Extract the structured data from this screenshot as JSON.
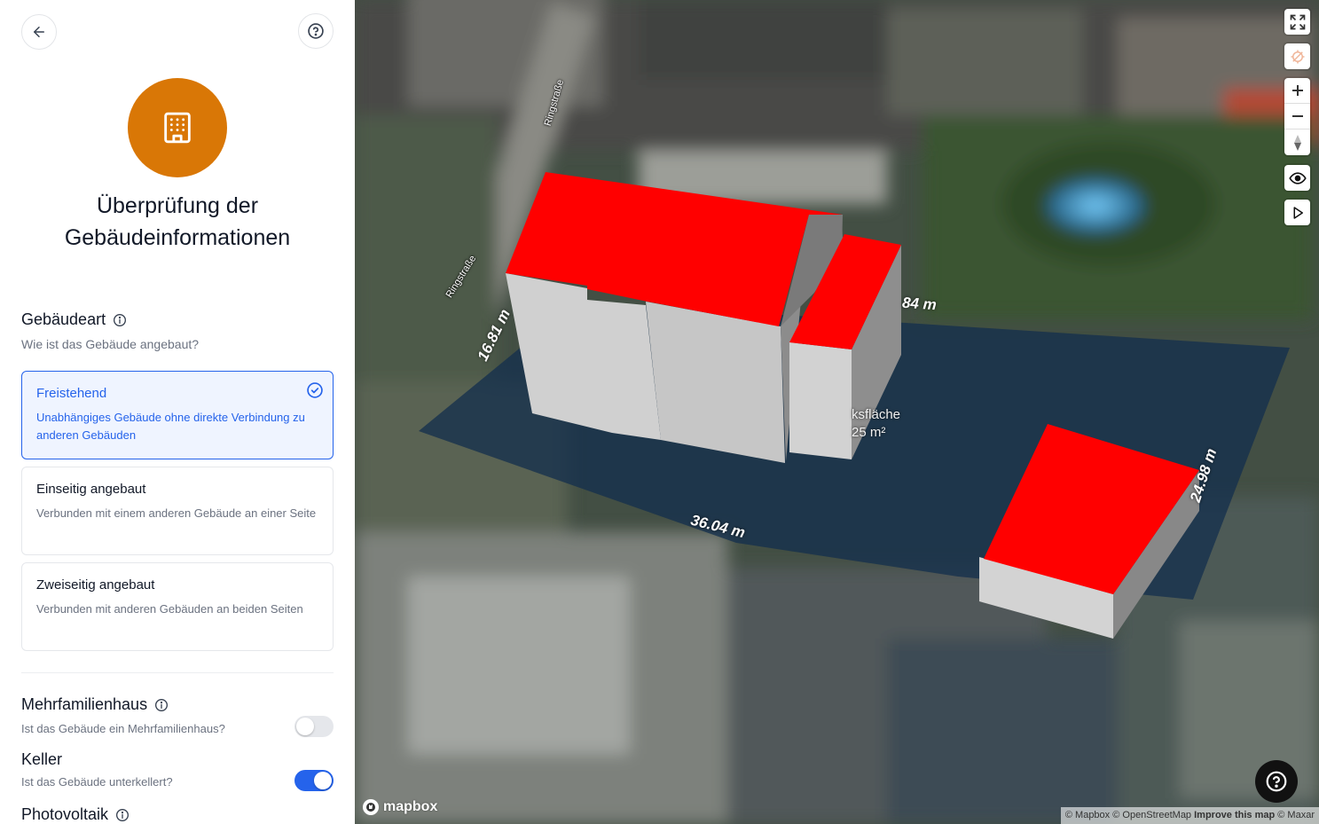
{
  "sidebar": {
    "title": "Überprüfung der Gebäudeinformationen",
    "building_type": {
      "heading": "Gebäudeart",
      "subtitle": "Wie ist das Gebäude angebaut?",
      "options": [
        {
          "title": "Freistehend",
          "desc": "Unabhängiges Gebäude ohne direkte Verbindung zu anderen Gebäuden",
          "selected": true
        },
        {
          "title": "Einseitig angebaut",
          "desc": "Verbunden mit einem anderen Gebäude an einer Seite",
          "selected": false
        },
        {
          "title": "Zweiseitig angebaut",
          "desc": "Verbunden mit anderen Gebäuden an beiden Seiten",
          "selected": false
        }
      ]
    },
    "multifamily": {
      "heading": "Mehrfamilienhaus",
      "subtitle": "Ist das Gebäude ein Mehrfamilienhaus?",
      "enabled": false
    },
    "basement": {
      "heading": "Keller",
      "subtitle": "Ist das Gebäude unterkellert?",
      "enabled": true
    },
    "photovoltaic": {
      "heading": "Photovoltaik"
    }
  },
  "map": {
    "street_labels": [
      "Ringstraße",
      "Ringstraße"
    ],
    "dimensions": {
      "left": "16.81 m",
      "top": "84 m",
      "bottom": "36.04 m",
      "right": "24.98 m"
    },
    "area": {
      "label": "ksfläche",
      "value": "25 m²"
    },
    "logo": "mapbox",
    "attribution": {
      "mapbox": "© Mapbox",
      "osm": "© OpenStreetMap",
      "improve": "Improve this map",
      "maxar": "© Maxar"
    }
  },
  "colors": {
    "accent": "#2563eb",
    "hero": "#d97706",
    "roof": "#ff0000"
  }
}
